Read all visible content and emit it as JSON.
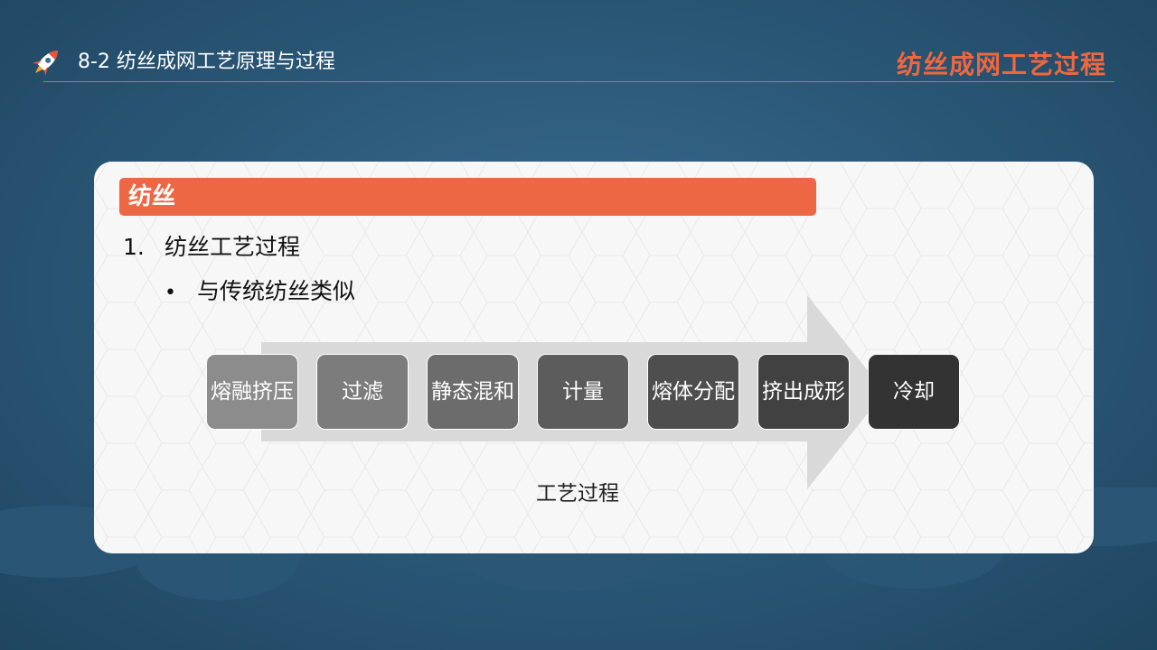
{
  "header": {
    "section_title": "8-2 纺丝成网工艺原理与过程",
    "topic_title": "纺丝成网工艺过程"
  },
  "card": {
    "heading": "纺丝",
    "list_item": {
      "number": "1.",
      "text": "纺丝工艺过程"
    },
    "bullet": {
      "marker": "•",
      "text": "与传统纺丝类似"
    },
    "flow": {
      "steps": [
        {
          "label": "熔融挤压",
          "color": "#8c8c8c"
        },
        {
          "label": "过滤",
          "color": "#7c7c7c"
        },
        {
          "label": "静态混和",
          "color": "#6c6c6c"
        },
        {
          "label": "计量",
          "color": "#5c5c5c"
        },
        {
          "label": "熔体分配",
          "color": "#4e4e4e"
        },
        {
          "label": "挤出成形",
          "color": "#414141"
        },
        {
          "label": "冷却",
          "color": "#333333"
        }
      ],
      "caption": "工艺过程"
    }
  },
  "colors": {
    "accent": "#ee6744",
    "background": "#2c5a7a",
    "card": "#f7f7f7",
    "arrow": "#d9d9d9"
  },
  "icons": {
    "header_icon": "rocket-icon"
  }
}
